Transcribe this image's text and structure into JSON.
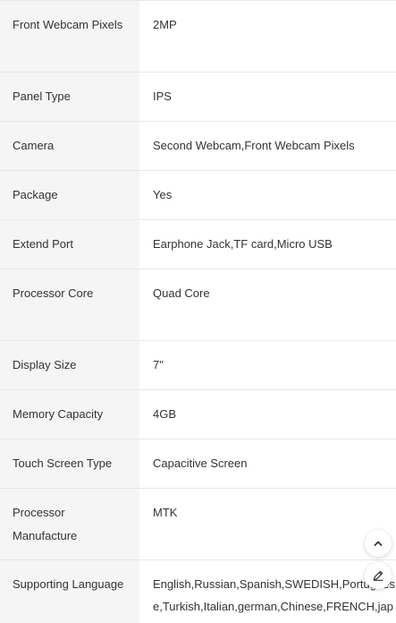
{
  "specs": [
    {
      "label": "Front Webcam Pixels",
      "value": "2MP"
    },
    {
      "label": "Panel Type",
      "value": "IPS"
    },
    {
      "label": "Camera",
      "value": "Second Webcam,Front Webcam Pixels"
    },
    {
      "label": "Package",
      "value": "Yes"
    },
    {
      "label": "Extend Port",
      "value": "Earphone Jack,TF card,Micro USB"
    },
    {
      "label": "Processor Core",
      "value": "Quad Core"
    },
    {
      "label": "Display Size",
      "value": "7\""
    },
    {
      "label": "Memory Capacity",
      "value": "4GB"
    },
    {
      "label": "Touch Screen Type",
      "value": "Capacitive Screen"
    },
    {
      "label": "Processor Manufacture",
      "value": "MTK"
    },
    {
      "label": "Supporting Language",
      "value": "English,Russian,Spanish,SWEDISH,Portuguese,Turkish,Italian,german,Chinese,FRENCH,japa"
    }
  ],
  "icons": {
    "scroll_top": "chevron-up-icon",
    "edit": "pencil-icon"
  }
}
